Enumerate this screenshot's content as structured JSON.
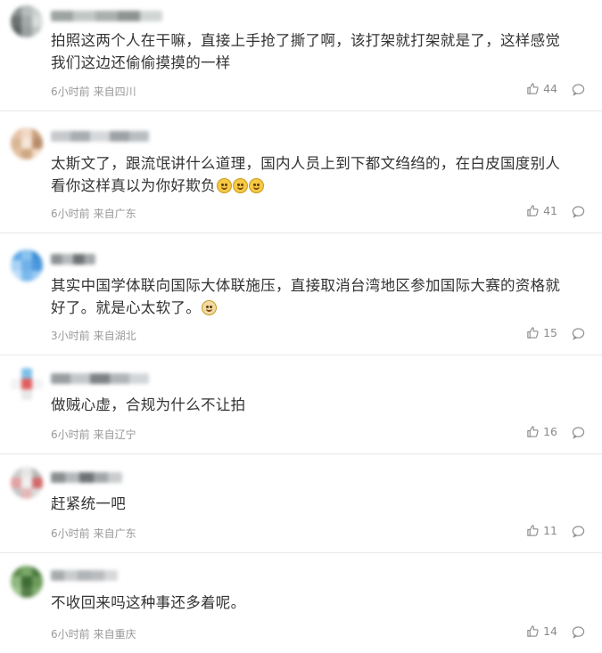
{
  "comments": [
    {
      "text": "拍照这两个人在干嘛，直接上手抢了撕了啊，该打架就打架就是了，这样感觉我们这边还偷偷摸摸的一样",
      "time": "6小时前",
      "location": "来自四川",
      "likes": "44",
      "emojis": [],
      "avatar_colors": [
        "#8a8f8f",
        "#b7bcbc",
        "#c9d2d0",
        "#6b7272",
        "#a3aaa8",
        "#d8dedc",
        "#5d6464",
        "#9aa1a0",
        "#bfc5c3"
      ],
      "name_colors": [
        "#9ea4a3",
        "#c2c7c6",
        "#aab0af",
        "#8e9493",
        "#d1d5d4"
      ]
    },
    {
      "text": "太斯文了，跟流氓讲什么道理，国内人员上到下都文绉绉的，在白皮国度别人看你这样真以为你好欺负",
      "time": "6小时前",
      "location": "来自广东",
      "likes": "41",
      "emojis": [
        "smile-sweat-emoji",
        "smile-sweat-emoji",
        "smile-sweat-emoji"
      ],
      "avatar_colors": [
        "#e6c5a8",
        "#f0d9c6",
        "#c89f7c",
        "#d9b696",
        "#f5e6d8",
        "#b98d6b",
        "#e2c0a1",
        "#cfa884",
        "#f2dcc9"
      ],
      "name_colors": [
        "#c5c9cb",
        "#a8adb0",
        "#d6d9db",
        "#9da2a5",
        "#b9bdc0"
      ]
    },
    {
      "text": "其实中国学体联向国际大体联施压，直接取消台湾地区参加国际大赛的资格就好了。就是心太软了。",
      "time": "3小时前",
      "location": "来自湖北",
      "likes": "15",
      "emojis": [
        "dog-emoji"
      ],
      "avatar_colors": [
        "#5fa7e6",
        "#8cc3f0",
        "#3f8ed6",
        "#a9d3f5",
        "#6fb0ea",
        "#4b97dc",
        "#c3e0f8",
        "#7ab9ec",
        "#9ccbf2"
      ],
      "name_colors": [
        "#8e9294",
        "#b7babc",
        "#6e7274",
        "#a4a8aa"
      ]
    },
    {
      "text": "做贼心虚，合规为什么不让拍",
      "time": "6小时前",
      "location": "来自辽宁",
      "likes": "16",
      "emojis": [],
      "avatar_colors": [
        "#ffffff",
        "#7fc0e8",
        "#ffffff",
        "#f3f3f3",
        "#e25d5d",
        "#f3f3f3",
        "#ffffff",
        "#e8e8e8",
        "#ffffff"
      ],
      "name_colors": [
        "#9a9ea0",
        "#c4c7c9",
        "#7e8284",
        "#b1b5b7",
        "#d3d6d8"
      ]
    },
    {
      "text": "赶紧统一吧",
      "time": "6小时前",
      "location": "来自广东",
      "likes": "11",
      "emojis": [],
      "avatar_colors": [
        "#cfcfcf",
        "#e7e7e7",
        "#b9b9b9",
        "#e2a3a3",
        "#f0f0f0",
        "#d26a6a",
        "#c7c7c7",
        "#e5b8b8",
        "#dddddd"
      ],
      "name_colors": [
        "#8a8e90",
        "#b5b8ba",
        "#6f7375",
        "#a2a6a8",
        "#c9cccd"
      ]
    },
    {
      "text": "不收回来吗这种事还多着呢。",
      "time": "6小时前",
      "location": "来自重庆",
      "likes": "14",
      "emojis": [],
      "avatar_colors": [
        "#5e8e4f",
        "#7aa86a",
        "#4a7a3e",
        "#8fb87f",
        "#3f6b35",
        "#6c9b5c",
        "#a2c593",
        "#557f48",
        "#80ad70"
      ],
      "name_colors": [
        "#a7abad",
        "#c9cccd",
        "#9195975",
        "#b9bcbe",
        "#d6d8d9"
      ]
    }
  ],
  "icons": {
    "like": "thumbs-up-icon",
    "reply": "comment-bubble-icon"
  },
  "colors": {
    "meta": "#999999",
    "text": "#333333",
    "divider": "#e8e8e8"
  }
}
